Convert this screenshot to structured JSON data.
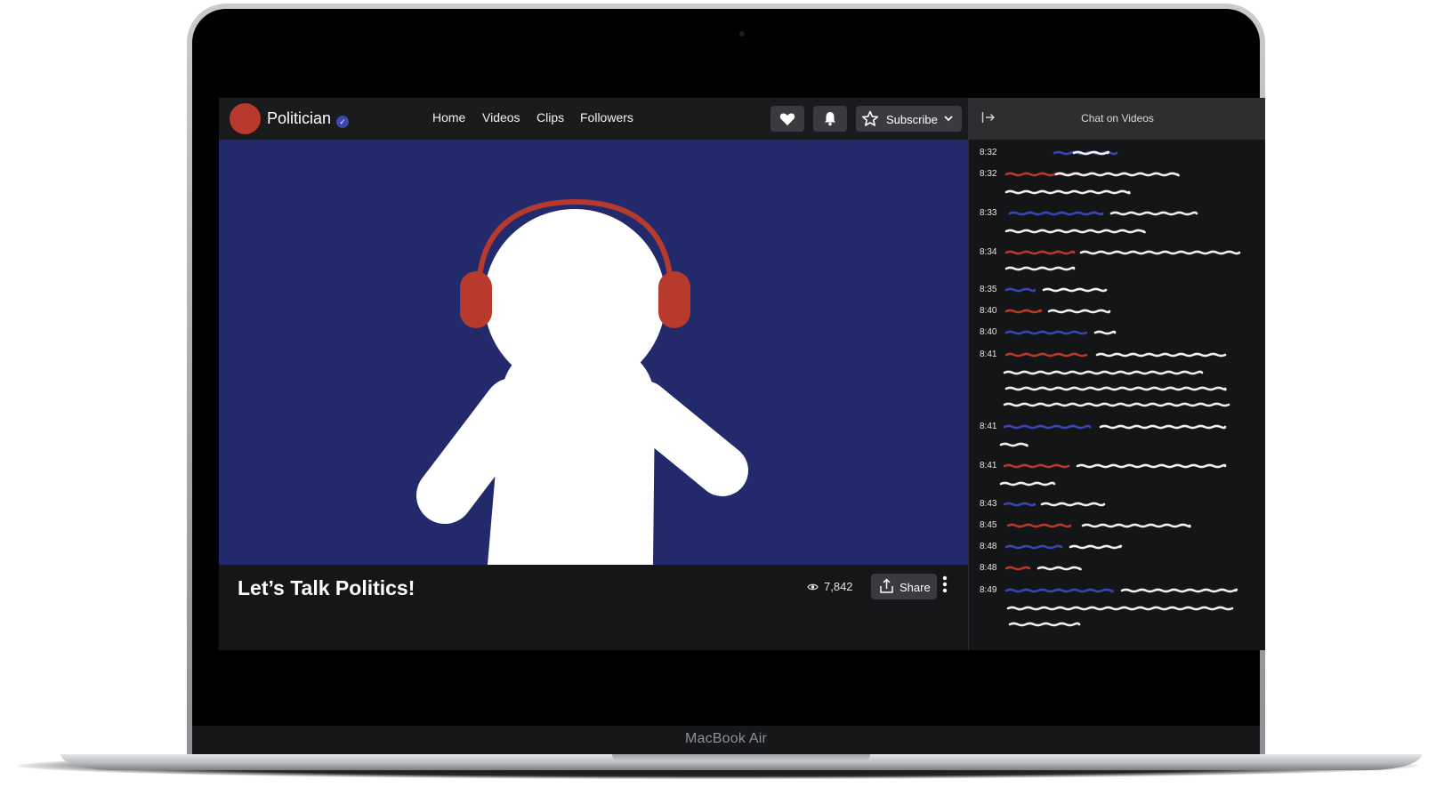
{
  "device": {
    "brand": "MacBook Air"
  },
  "channel": {
    "name": "Politician",
    "verified_icon": "check-badge-icon"
  },
  "nav": {
    "items": [
      "Home",
      "Videos",
      "Clips",
      "Followers"
    ]
  },
  "actions": {
    "like_icon": "heart-icon",
    "notify_icon": "bell-icon",
    "subscribe_label": "Subscribe"
  },
  "video": {
    "title": "Let’s Talk Politics!",
    "views": "7,842",
    "share_label": "Share"
  },
  "chat": {
    "title": "Chat on Videos",
    "messages": [
      {
        "time": "8:32",
        "name_color": "blue"
      },
      {
        "time": "8:32",
        "name_color": "red"
      },
      {
        "time": "8:33",
        "name_color": "blue"
      },
      {
        "time": "8:34",
        "name_color": "red"
      },
      {
        "time": "8:35",
        "name_color": "blue"
      },
      {
        "time": "8:40",
        "name_color": "red"
      },
      {
        "time": "8:40",
        "name_color": "blue"
      },
      {
        "time": "8:41",
        "name_color": "red"
      },
      {
        "time": "8:41",
        "name_color": "blue"
      },
      {
        "time": "8:41",
        "name_color": "red"
      },
      {
        "time": "8:43",
        "name_color": "blue"
      },
      {
        "time": "8:45",
        "name_color": "red"
      },
      {
        "time": "8:48",
        "name_color": "blue"
      },
      {
        "time": "8:48",
        "name_color": "red"
      },
      {
        "time": "8:49",
        "name_color": "blue"
      }
    ]
  },
  "colors": {
    "video_bg": "#232a6b",
    "accent_red": "#b83a2c",
    "accent_blue": "#3847b5",
    "chat_bg": "#141517"
  }
}
